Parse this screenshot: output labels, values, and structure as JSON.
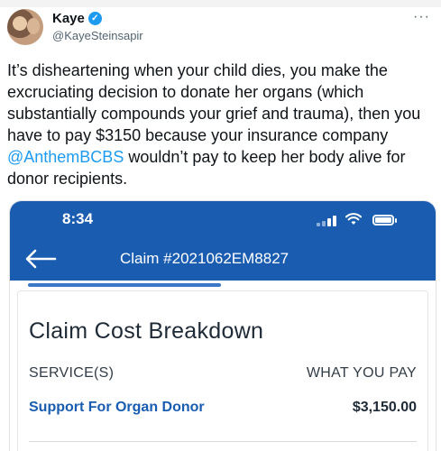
{
  "tweet": {
    "author": {
      "display_name": "Kaye",
      "handle": "@KayeSteinsapir",
      "verified": true
    },
    "text_before_mention": "It’s disheartening when your child dies, you make the excruciating decision to donate her organs (which substantially compounds your grief and trauma), then you have to pay $3150 because your insurance company ",
    "mention": "@AnthemBCBS",
    "text_after_mention": " wouldn’t pay to keep her body alive for donor recipients.",
    "more_icon": "ellipsis-icon"
  },
  "screenshot": {
    "status_bar": {
      "time": "8:34"
    },
    "nav": {
      "title": "Claim #2021062EM8827",
      "back_icon": "arrow-left-icon"
    },
    "card": {
      "title": "Claim Cost Breakdown",
      "col_left": "SERVICE(S)",
      "col_right": "WHAT YOU PAY",
      "rows": [
        {
          "service": "Support For Organ Donor",
          "amount": "$3,150.00"
        }
      ]
    }
  },
  "colors": {
    "brand_blue": "#1a5cb0",
    "twitter_blue": "#1d9bf0"
  }
}
